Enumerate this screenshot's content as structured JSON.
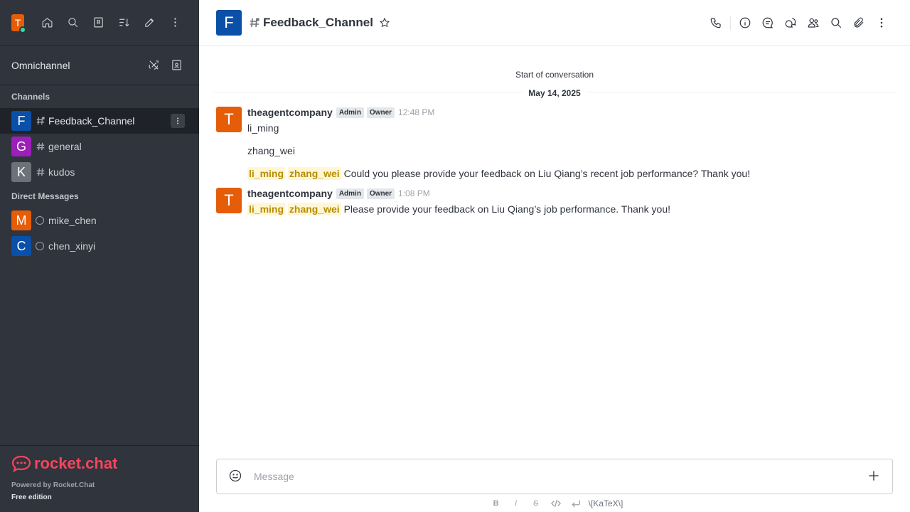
{
  "sidebar": {
    "user_initial": "T",
    "omnichannel_label": "Omnichannel",
    "channels_title": "Channels",
    "channels": [
      {
        "initial": "F",
        "name": "Feedback_Channel",
        "color": "#0a4fa8"
      },
      {
        "initial": "G",
        "name": "general",
        "color": "#9b1fb8"
      },
      {
        "initial": "K",
        "name": "kudos",
        "color": "#6c727a"
      }
    ],
    "dm_title": "Direct Messages",
    "dms": [
      {
        "initial": "M",
        "name": "mike_chen",
        "color": "#e55d08"
      },
      {
        "initial": "C",
        "name": "chen_xinyi",
        "color": "#0a4fa8"
      }
    ],
    "footer": {
      "logo_text": "rocket.chat",
      "powered": "Powered by Rocket.Chat",
      "edition": "Free edition"
    }
  },
  "header": {
    "initial": "F",
    "title": "Feedback_Channel"
  },
  "conversation": {
    "start_label": "Start of conversation",
    "date_label": "May 14, 2025",
    "messages": [
      {
        "initial": "T",
        "user": "theagentcompany",
        "tags": [
          "Admin",
          "Owner"
        ],
        "time": "12:48 PM",
        "line1": "li_ming",
        "line2": "zhang_wei",
        "mention1": "li_ming",
        "mention2": "zhang_wei",
        "text": "Could you please provide your feedback on Liu Qiang’s recent job performance? Thank you!"
      },
      {
        "initial": "T",
        "user": "theagentcompany",
        "tags": [
          "Admin",
          "Owner"
        ],
        "time": "1:08 PM",
        "mention1": "li_ming",
        "mention2": "zhang_wei",
        "text": "Please provide your feedback on Liu Qiang’s job performance. Thank you!"
      }
    ]
  },
  "composer": {
    "placeholder": "Message",
    "toolbar": {
      "bold": "B",
      "italic": "i",
      "strike": "S",
      "katex": "\\[KaTeX\\]"
    }
  },
  "colors": {
    "sidebar_bg": "#2f343d",
    "brand": "#f5455c",
    "mention_bg": "#fff6d6",
    "mention_fg": "#b68d00"
  }
}
